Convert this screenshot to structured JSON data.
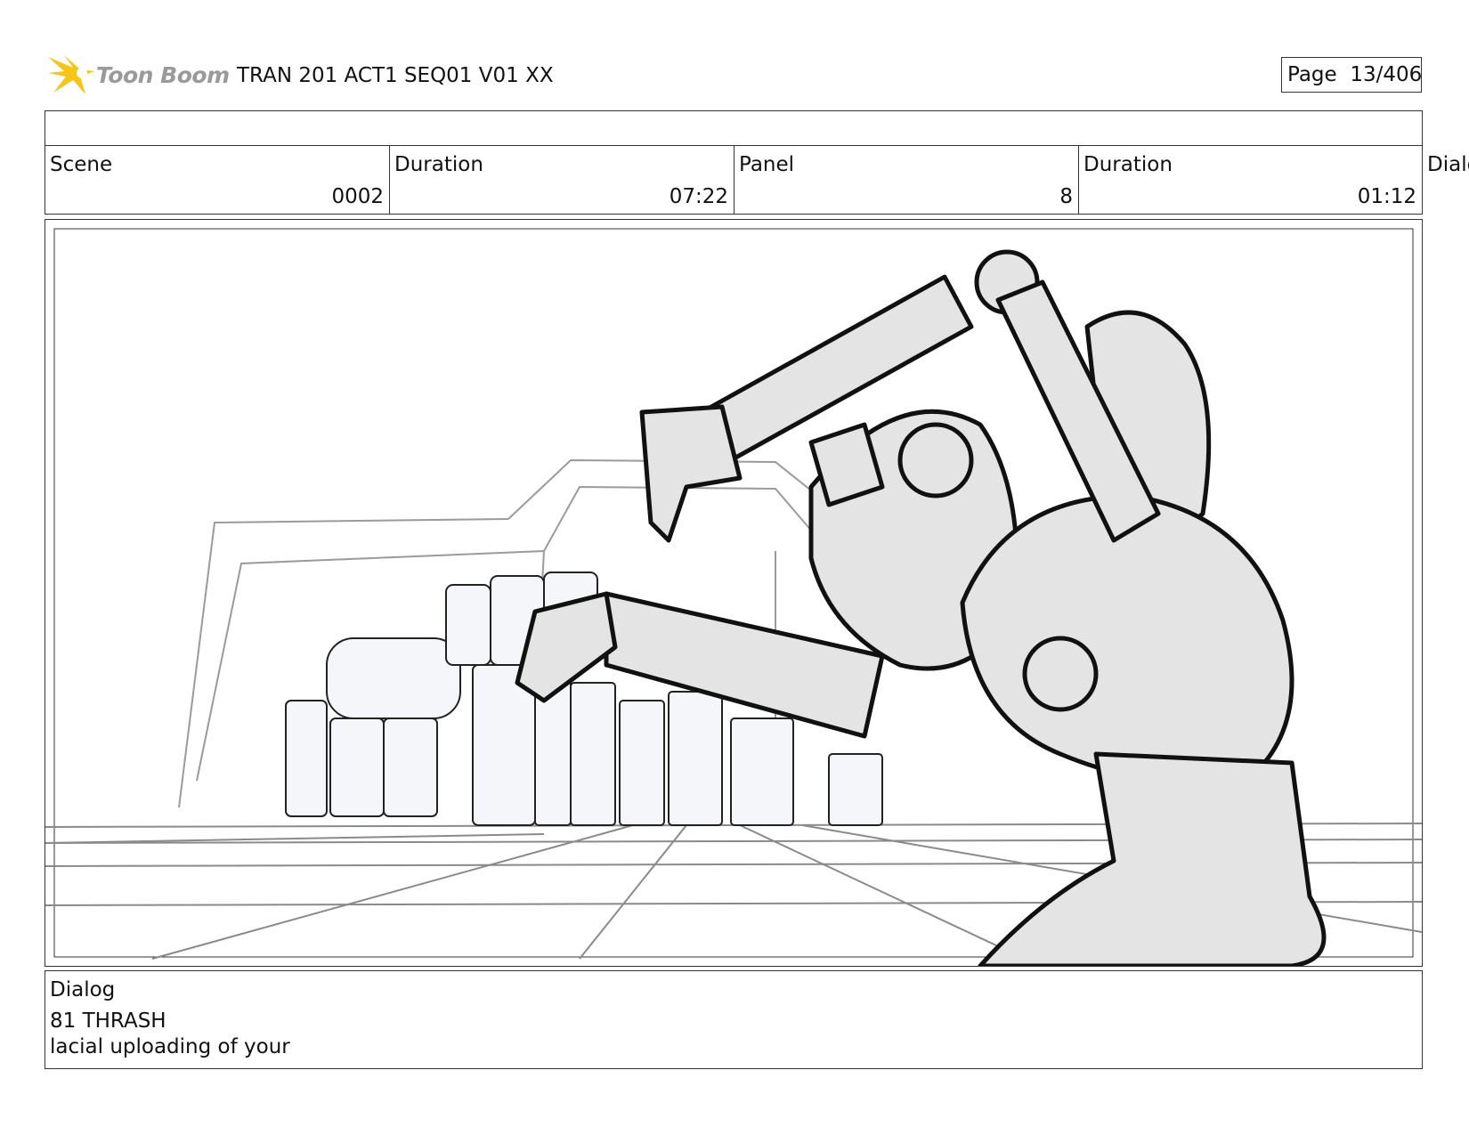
{
  "header": {
    "logo_text": "Toon Boom",
    "title": "TRAN 201 ACT1 SEQ01 V01 XX",
    "page_label": "Page",
    "page_value": "13/406"
  },
  "info": {
    "scene_label": "Scene",
    "scene_value": "0002",
    "scene_duration_label": "Duration",
    "scene_duration_value": "07:22",
    "panel_label": "Panel",
    "panel_value": "8",
    "panel_duration_label": "Duration",
    "panel_duration_value": "01:12",
    "overflow_label": "Dialo"
  },
  "dialog": {
    "label": "Dialog",
    "line1": "81 THRASH",
    "line2": "lacial uploading of your"
  },
  "colors": {
    "logo_flash": "#f5c518",
    "logo_text": "#9a9a9a",
    "sketch_fill": "#e4e4e4",
    "sketch_line": "#111111",
    "grid_line": "#8a8a8a"
  }
}
